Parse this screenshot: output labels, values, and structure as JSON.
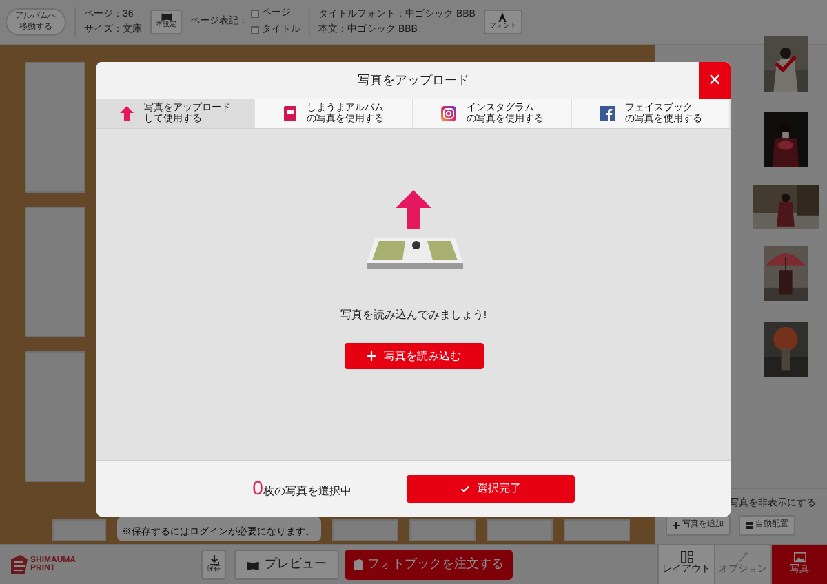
{
  "toolbar": {
    "back_button": [
      "アルバムへ",
      "移動する"
    ],
    "page_info": [
      "ページ：36",
      "サイズ：文庫"
    ],
    "settings_button": "本設定",
    "page_label_title": "ページ表記：",
    "page_label_options": [
      {
        "label": "ページ",
        "checked": false
      },
      {
        "label": "タイトル",
        "checked": false
      }
    ],
    "fonts": [
      "タイトルフォント：中ゴシック BBB",
      "本文：中ゴシック BBB"
    ],
    "font_button": "フォント"
  },
  "canvas": {
    "notice": "※保存するにはログインが必要になります。"
  },
  "photo_panel": {
    "photos": [
      {
        "kind": "picture",
        "checked": true
      },
      {
        "kind": "picture",
        "checked": false
      },
      {
        "kind": "picture",
        "checked": false
      },
      {
        "kind": "picture",
        "checked": false
      },
      {
        "kind": "picture",
        "checked": false
      }
    ],
    "hide_label": "写真を非表示にする",
    "add_button": "写真を追加",
    "auto_button": "自動配置"
  },
  "bottom_bar": {
    "logo": [
      "SHIMAUMA",
      "PRINT"
    ],
    "save_button": "保存",
    "preview_button": "プレビュー",
    "order_button": "フォトブックを注文する",
    "tabs": [
      {
        "label": "レイアウト",
        "selected": false,
        "disabled": false
      },
      {
        "label": "オプション",
        "selected": false,
        "disabled": true
      },
      {
        "label": "写真",
        "selected": true,
        "disabled": false
      }
    ]
  },
  "dialog": {
    "title": "写真をアップロード",
    "close": "×",
    "tabs": [
      {
        "kind": "upload",
        "lines": [
          "写真をアップロード",
          "して使用する"
        ],
        "selected": true
      },
      {
        "kind": "album",
        "lines": [
          "しまうまアルバム",
          "の写真を使用する"
        ],
        "selected": false
      },
      {
        "kind": "instagram",
        "lines": [
          "インスタグラム",
          "の写真を使用する"
        ],
        "selected": false
      },
      {
        "kind": "facebook",
        "lines": [
          "フェイスブック",
          "の写真を使用する"
        ],
        "selected": false
      }
    ],
    "prompt": "写真を読み込んでみましょう!",
    "load_button": "写真を読み込む",
    "selected_count": "0",
    "selected_text": "枚の写真を選択中",
    "done_button": "選択完了"
  }
}
